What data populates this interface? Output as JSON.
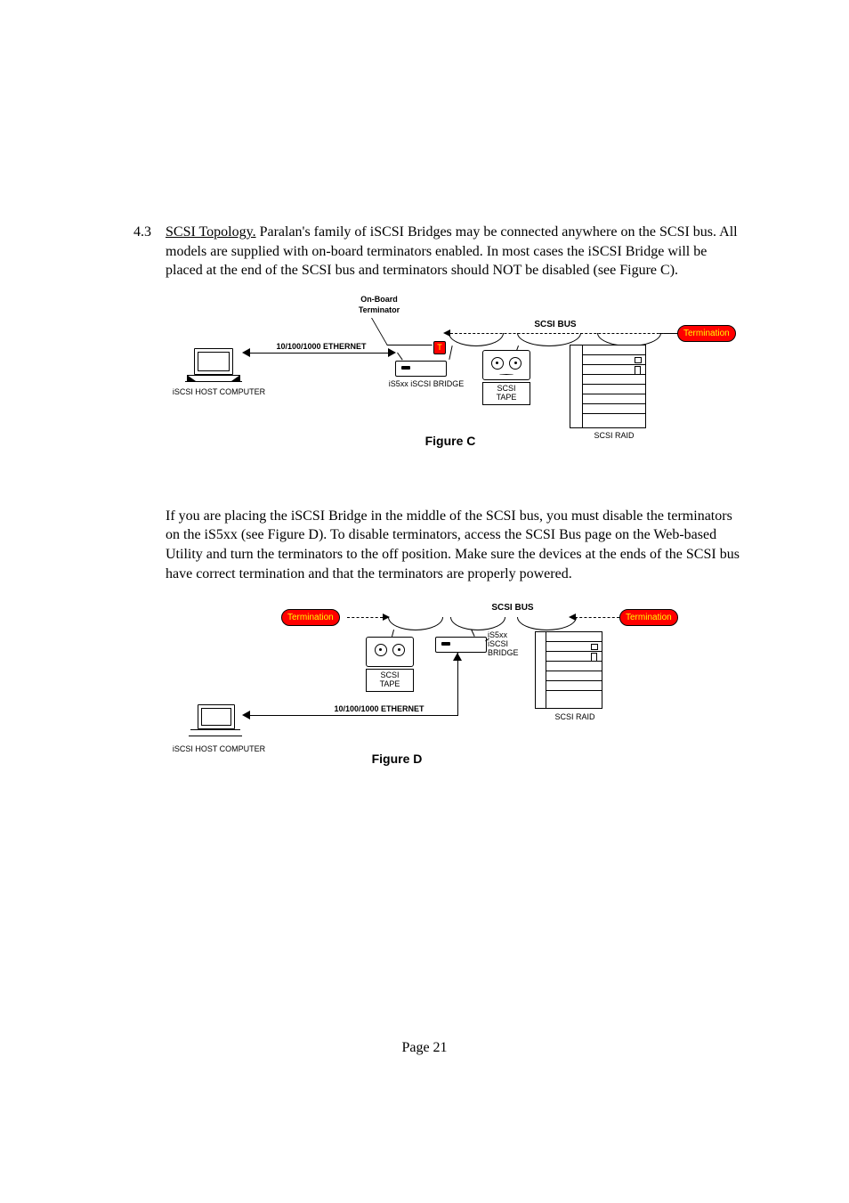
{
  "sectionNumber": "4.3",
  "heading": "SCSI Topology.",
  "para1_rest": "  Paralan's family of iSCSI Bridges may be connected anywhere on the SCSI bus.  All models are supplied with on-board terminators enabled.  In most cases the iSCSI Bridge will be placed at the end of the SCSI bus and terminators should NOT be disabled (see Figure C).",
  "para2": "If you are placing the iSCSI Bridge in the middle of the SCSI bus, you must disable the terminators on the iS5xx (see Figure D).  To disable terminators, access the SCSI Bus page on the Web-based Utility and turn the terminators to the off position.  Make sure the devices at the ends of the SCSI bus have correct termination and that the terminators are properly powered.",
  "figC": {
    "title": "Figure C",
    "onboard1": "On-Board",
    "onboard2": "Terminator",
    "termT": "T",
    "ethernet": "10/100/1000 ETHERNET",
    "host": "iSCSI HOST COMPUTER",
    "bridge": "iS5xx iSCSI BRIDGE",
    "scsiBus": "SCSI BUS",
    "tape1": "SCSI",
    "tape2": "TAPE",
    "raid": "SCSI RAID",
    "termination": "Termination"
  },
  "figD": {
    "title": "Figure D",
    "terminationL": "Termination",
    "terminationR": "Termination",
    "scsiBus": "SCSI BUS",
    "bridge1": "iS5xx",
    "bridge2": "iSCSI",
    "bridge3": "BRIDGE",
    "tape1": "SCSI",
    "tape2": "TAPE",
    "ethernet": "10/100/1000 ETHERNET",
    "host": "iSCSI HOST COMPUTER",
    "raid": "SCSI RAID"
  },
  "footer": "Page 21"
}
